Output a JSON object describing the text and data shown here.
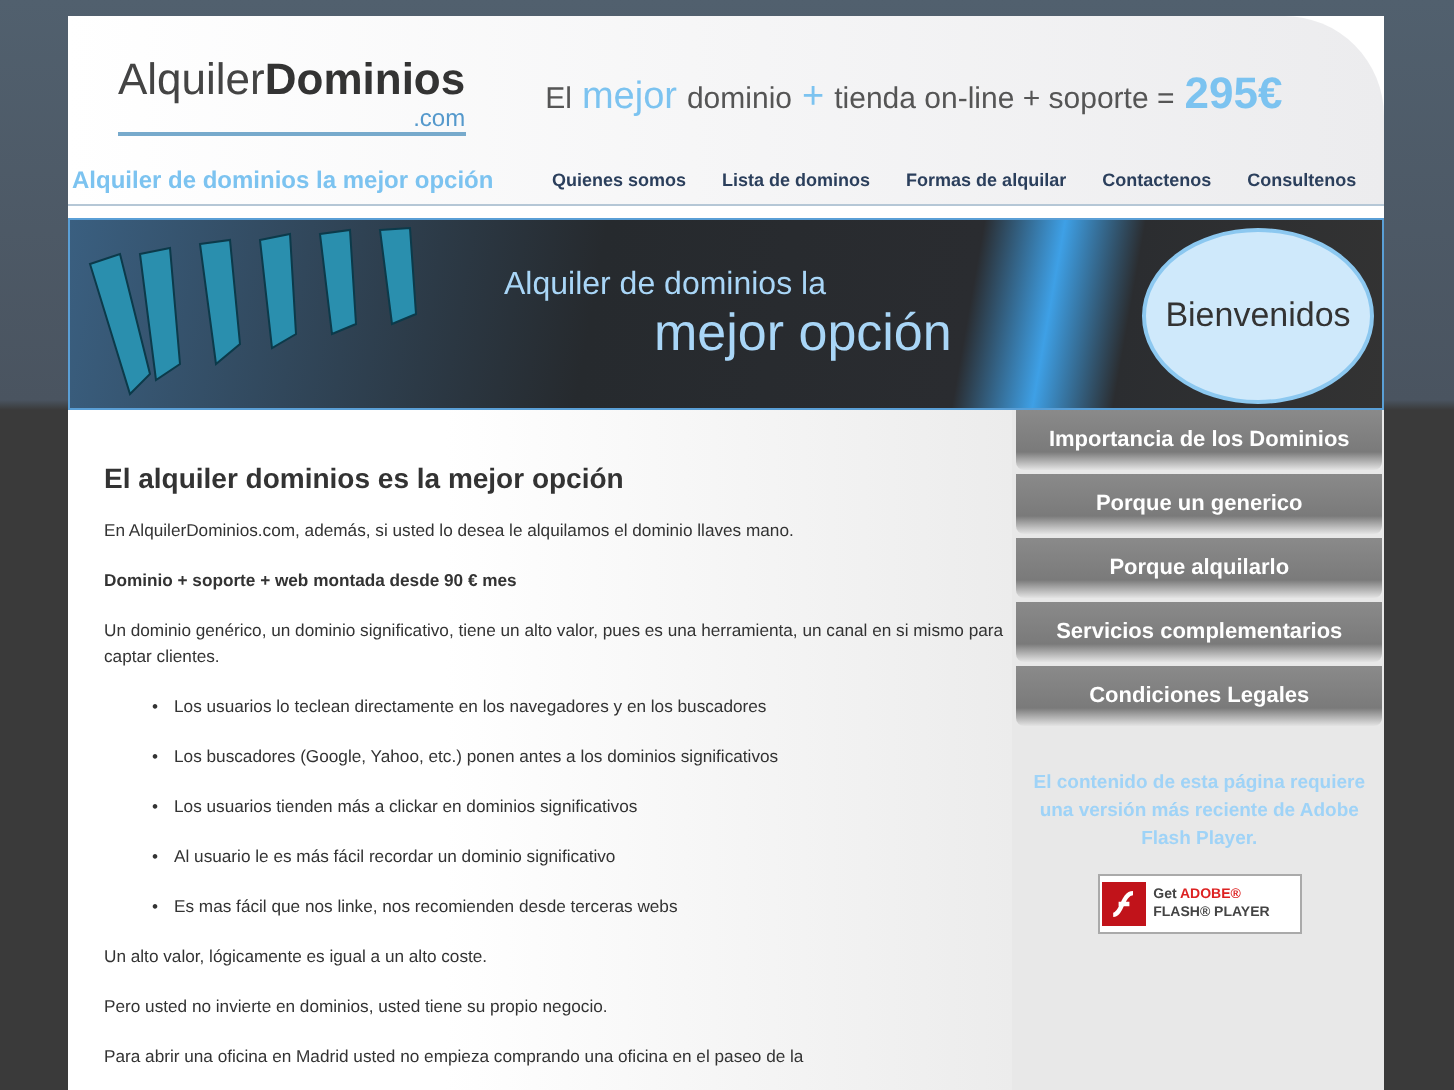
{
  "header": {
    "logo": {
      "light": "Alquiler",
      "bold": "Dominios",
      "tld": ".com"
    },
    "slogan": [
      {
        "text": "El",
        "kind": "plain"
      },
      {
        "text": "mejor",
        "kind": "accent"
      },
      {
        "text": "dominio",
        "kind": "plain"
      },
      {
        "text": "+",
        "kind": "accent"
      },
      {
        "text": "tienda on-line + soporte =",
        "kind": "plain"
      },
      {
        "text": "295€",
        "kind": "price"
      }
    ],
    "tagline": "Alquiler de dominios la mejor opción",
    "nav": [
      "Quienes somos",
      "Lista de dominos",
      "Formas de alquilar",
      "Contactenos",
      "Consultenos"
    ]
  },
  "banner": {
    "line_1": "Alquiler de dominios la",
    "line_2": "mejor opción",
    "badge": "Bienvenidos"
  },
  "main": {
    "heading": "El alquiler dominios es la mejor opción",
    "blocks": [
      {
        "kind": "paragraph",
        "text": "En AlquilerDominios.com, además, si usted lo desea le alquilamos el dominio llaves mano."
      },
      {
        "kind": "strong",
        "text": "Dominio + soporte + web montada desde 90 € mes"
      },
      {
        "kind": "paragraph",
        "text": "Un dominio genérico, un dominio significativo, tiene un alto valor, pues es una herramienta, un canal en si mismo para captar clientes."
      },
      {
        "kind": "list",
        "marker": "•",
        "items": [
          "Los usuarios lo teclean directamente en los navegadores y en los buscadores",
          "Los buscadores (Google, Yahoo, etc.) ponen antes a los dominios significativos",
          "Los usuarios tienden más a clickar en dominios significativos",
          "Al usuario le es más fácil recordar un dominio significativo",
          "Es mas fácil que nos linke, nos recomienden desde terceras webs"
        ]
      },
      {
        "kind": "paragraph",
        "text": "Un alto valor, lógicamente es igual a un alto coste."
      },
      {
        "kind": "paragraph",
        "text": "Pero usted no invierte en dominios, usted tiene su propio negocio."
      },
      {
        "kind": "paragraph",
        "text": "Para abrir una oficina en Madrid usted no empieza comprando una oficina en el paseo de la"
      }
    ]
  },
  "sidebar": {
    "menu": [
      "Importancia de los Dominios",
      "Porque un generico",
      "Porque alquilarlo",
      "Servicios complementarios",
      "Condiciones Legales"
    ],
    "flash_notice": "El contenido de esta página requiere una versión más reciente de Adobe Flash Player.",
    "flash_badge": {
      "get": "Get",
      "brand": "ADOBE®",
      "product": "FLASH® PLAYER"
    }
  }
}
